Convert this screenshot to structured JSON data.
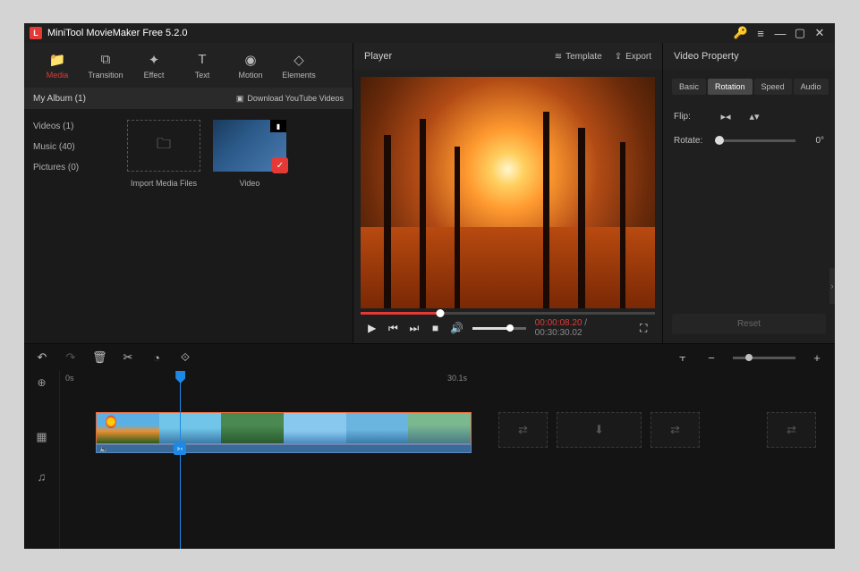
{
  "titlebar": {
    "app_title": "MiniTool MovieMaker Free 5.2.0"
  },
  "toolbar": {
    "media": "Media",
    "transition": "Transition",
    "effect": "Effect",
    "text": "Text",
    "motion": "Motion",
    "elements": "Elements"
  },
  "album": {
    "header": "My Album (1)",
    "download_label": "Download YouTube Videos",
    "nav": {
      "videos": "Videos (1)",
      "music": "Music (40)",
      "pictures": "Pictures (0)"
    },
    "import_label": "Import Media Files",
    "video_tile_label": "Video"
  },
  "player": {
    "label": "Player",
    "template_label": "Template",
    "export_label": "Export",
    "current_time": "00:00:08.20",
    "total_time": "00:30:30.02",
    "sep": " / ",
    "progress_pct": 27
  },
  "props": {
    "label": "Video Property",
    "tabs": {
      "basic": "Basic",
      "rotation": "Rotation",
      "speed": "Speed",
      "audio": "Audio"
    },
    "flip_label": "Flip:",
    "rotate_label": "Rotate:",
    "rotate_value": "0°",
    "reset_label": "Reset"
  },
  "timeline": {
    "ruler": {
      "t0": "0s",
      "t1": "30.1s"
    },
    "playhead_pct": 15.5
  }
}
